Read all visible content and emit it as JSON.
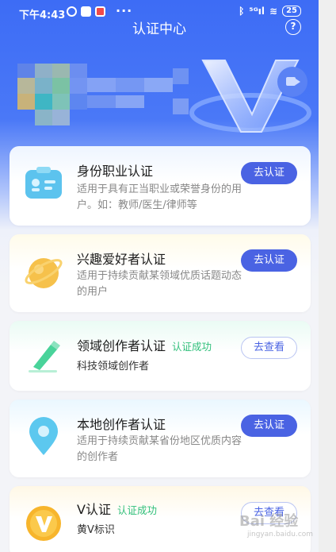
{
  "status_bar": {
    "time": "下午4:43",
    "dots": "···",
    "signal": "⁵ᴳıl",
    "wifi": "≋",
    "battery": "25"
  },
  "header": {
    "title": "认证中心",
    "help_icon": "?"
  },
  "cards": [
    {
      "title": "身份职业认证",
      "desc": "适用于具有正当职业或荣誉身份的用户。如：教师/医生/律师等",
      "button": "去认证",
      "icon": "id-card-icon",
      "color": "#5cc3ee"
    },
    {
      "title": "兴趣爱好者认证",
      "desc": "适用于持续贡献某领域优质话题动态的用户",
      "button": "去认证",
      "icon": "planet-icon",
      "color": "#f6c14b"
    },
    {
      "title": "领域创作者认证",
      "badge": "认证成功",
      "sub": "科技领域创作者",
      "button": "去查看",
      "icon": "pen-icon",
      "color": "#49d39a"
    },
    {
      "title": "本地创作者认证",
      "desc": "适用于持续贡献某省份地区优质内容的创作者",
      "button": "去认证",
      "icon": "location-pin-icon",
      "color": "#5cc8ef"
    },
    {
      "title": "V认证",
      "badge": "认证成功",
      "sub": "黄V标识",
      "button": "去查看",
      "icon": "v-badge-icon",
      "color": "#f7b52c"
    }
  ],
  "watermark": {
    "text": "Bai 经验",
    "sub": "jingyan.baidu.com"
  }
}
